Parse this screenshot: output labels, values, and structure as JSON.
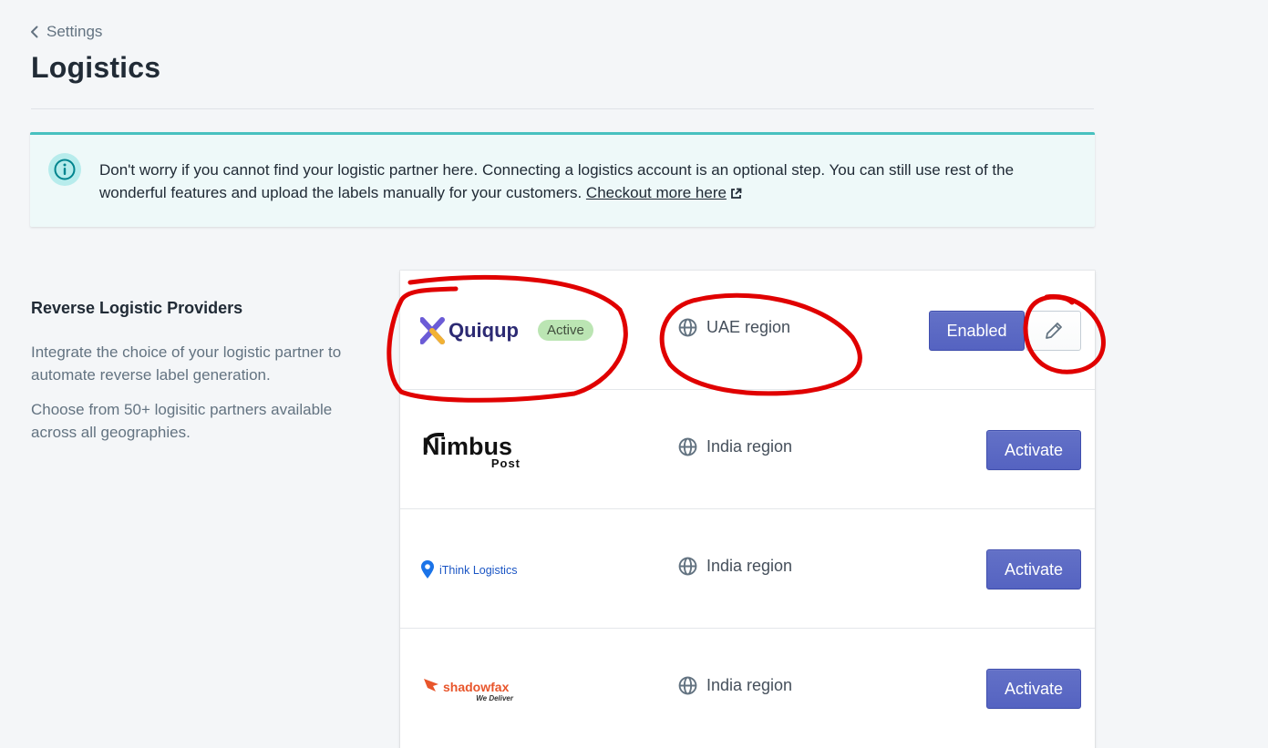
{
  "breadcrumb": {
    "label": "Settings"
  },
  "page": {
    "title": "Logistics"
  },
  "banner": {
    "text": "Don't worry if you cannot find your logistic partner here. Connecting a logistics account is an optional step. You can still use rest of the wonderful features and upload the labels manually for your customers.",
    "link_label": "Checkout more here"
  },
  "section": {
    "title": "Reverse Logistic Providers",
    "desc1": "Integrate the choice of your logistic partner to automate reverse label generation.",
    "desc2": "Choose from 50+ logisitic partners available across all geographies."
  },
  "providers": [
    {
      "name": "Quiqup",
      "badge": "Active",
      "region": "UAE region",
      "button": "Enabled"
    },
    {
      "name": "Nimbus",
      "sub": "Post",
      "region": "India region",
      "button": "Activate"
    },
    {
      "name": "iThink Logistics",
      "region": "India region",
      "button": "Activate"
    },
    {
      "name": "shadowfax",
      "sub": "We Deliver",
      "region": "India region",
      "button": "Activate"
    }
  ],
  "colors": {
    "primary": "#5c6ac4",
    "banner_accent": "#47c1bf",
    "badge_success": "#bbe5b3",
    "annotation": "#e00000"
  },
  "icons": {
    "back": "chevron-left-icon",
    "info": "info-circle-icon",
    "external": "external-link-icon",
    "region": "globe-icon",
    "edit": "pencil-icon"
  }
}
